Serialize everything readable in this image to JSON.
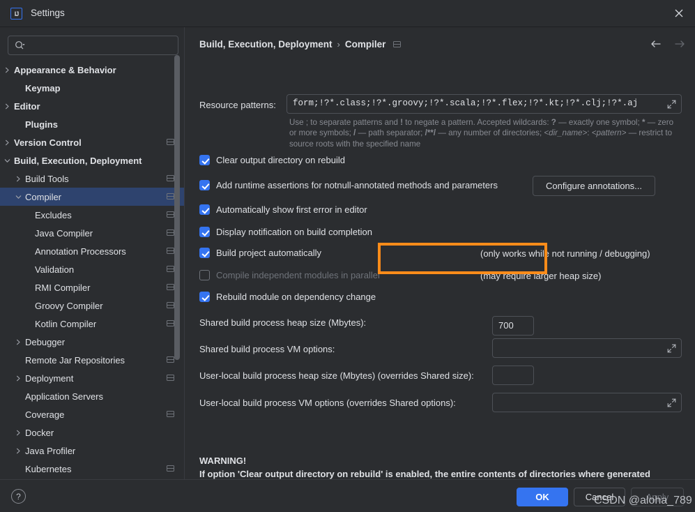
{
  "window": {
    "title": "Settings",
    "logo_text": "IJ",
    "close_icon": "close-icon"
  },
  "sidebar": {
    "search": {
      "placeholder": "",
      "value": "",
      "icon": "search-icon"
    },
    "items": [
      {
        "label": "Appearance & Behavior",
        "indent": 20,
        "arrow": "right",
        "bold": true,
        "badge": false,
        "selected": false
      },
      {
        "label": "Keymap",
        "indent": 36,
        "arrow": "none",
        "bold": true,
        "badge": false,
        "selected": false
      },
      {
        "label": "Editor",
        "indent": 20,
        "arrow": "right",
        "bold": true,
        "badge": false,
        "selected": false
      },
      {
        "label": "Plugins",
        "indent": 36,
        "arrow": "none",
        "bold": true,
        "badge": false,
        "selected": false
      },
      {
        "label": "Version Control",
        "indent": 20,
        "arrow": "right",
        "bold": true,
        "badge": true,
        "selected": false
      },
      {
        "label": "Build, Execution, Deployment",
        "indent": 20,
        "arrow": "down",
        "bold": true,
        "badge": false,
        "selected": false
      },
      {
        "label": "Build Tools",
        "indent": 36,
        "arrow": "right",
        "bold": false,
        "badge": true,
        "selected": false
      },
      {
        "label": "Compiler",
        "indent": 36,
        "arrow": "down",
        "bold": false,
        "badge": true,
        "selected": true
      },
      {
        "label": "Excludes",
        "indent": 50,
        "arrow": "none",
        "bold": false,
        "badge": true,
        "selected": false
      },
      {
        "label": "Java Compiler",
        "indent": 50,
        "arrow": "none",
        "bold": false,
        "badge": true,
        "selected": false
      },
      {
        "label": "Annotation Processors",
        "indent": 50,
        "arrow": "none",
        "bold": false,
        "badge": true,
        "selected": false
      },
      {
        "label": "Validation",
        "indent": 50,
        "arrow": "none",
        "bold": false,
        "badge": true,
        "selected": false
      },
      {
        "label": "RMI Compiler",
        "indent": 50,
        "arrow": "none",
        "bold": false,
        "badge": true,
        "selected": false
      },
      {
        "label": "Groovy Compiler",
        "indent": 50,
        "arrow": "none",
        "bold": false,
        "badge": true,
        "selected": false
      },
      {
        "label": "Kotlin Compiler",
        "indent": 50,
        "arrow": "none",
        "bold": false,
        "badge": true,
        "selected": false
      },
      {
        "label": "Debugger",
        "indent": 36,
        "arrow": "right",
        "bold": false,
        "badge": false,
        "selected": false
      },
      {
        "label": "Remote Jar Repositories",
        "indent": 36,
        "arrow": "none",
        "bold": false,
        "badge": true,
        "selected": false
      },
      {
        "label": "Deployment",
        "indent": 36,
        "arrow": "right",
        "bold": false,
        "badge": true,
        "selected": false
      },
      {
        "label": "Application Servers",
        "indent": 36,
        "arrow": "none",
        "bold": false,
        "badge": false,
        "selected": false
      },
      {
        "label": "Coverage",
        "indent": 36,
        "arrow": "none",
        "bold": false,
        "badge": true,
        "selected": false
      },
      {
        "label": "Docker",
        "indent": 36,
        "arrow": "right",
        "bold": false,
        "badge": false,
        "selected": false
      },
      {
        "label": "Java Profiler",
        "indent": 36,
        "arrow": "right",
        "bold": false,
        "badge": false,
        "selected": false
      },
      {
        "label": "Kubernetes",
        "indent": 36,
        "arrow": "none",
        "bold": false,
        "badge": true,
        "selected": false
      }
    ]
  },
  "main": {
    "breadcrumb": {
      "root": "Build, Execution, Deployment",
      "separator": "›",
      "leaf": "Compiler"
    },
    "nav": {
      "back_icon": "arrow-left-icon",
      "forward_icon": "arrow-right-icon"
    },
    "resource_patterns": {
      "label": "Resource patterns:",
      "value": "form;!?*.class;!?*.groovy;!?*.scala;!?*.flex;!?*.kt;!?*.clj;!?*.aj",
      "expand_icon": "expand-icon",
      "hint_line1_a": "Use ; to separate patterns and ",
      "hint_bang": "!",
      "hint_line1_b": " to negate a pattern. Accepted wildcards: ",
      "hint_q": "?",
      "hint_line1_c": " — exactly one symbol; ",
      "hint_star": "*",
      "hint_line1_d": " — zero or more symbols; ",
      "hint_slash": "/",
      "hint_line2_a": " — path separator; ",
      "hint_dstar": "/**/",
      "hint_line2_b": " — any number of directories; ",
      "hint_dir": "<dir_name>",
      "hint_colon": ": ",
      "hint_pattern": "<pattern>",
      "hint_line2_c": " — restrict to source roots with the specified name"
    },
    "checkboxes": [
      {
        "label": "Clear output directory on rebuild",
        "checked": true,
        "disabled": false,
        "note": ""
      },
      {
        "label": "Add runtime assertions for notnull-annotated methods and parameters",
        "checked": true,
        "disabled": false,
        "note": ""
      },
      {
        "label": "Automatically show first error in editor",
        "checked": true,
        "disabled": false,
        "note": ""
      },
      {
        "label": "Display notification on build completion",
        "checked": true,
        "disabled": false,
        "note": ""
      },
      {
        "label": "Build project automatically",
        "checked": true,
        "disabled": false,
        "note": "(only works while not running / debugging)"
      },
      {
        "label": "Compile independent modules in parallel",
        "checked": false,
        "disabled": true,
        "note": "(may require larger heap size)"
      },
      {
        "label": "Rebuild module on dependency change",
        "checked": true,
        "disabled": false,
        "note": ""
      }
    ],
    "configure_annotations_button": "Configure annotations...",
    "fields": [
      {
        "label": "Shared build process heap size (Mbytes):",
        "value": "700",
        "expandable": false
      },
      {
        "label": "Shared build process VM options:",
        "value": "",
        "expandable": true
      },
      {
        "label": "User-local build process heap size (Mbytes) (overrides Shared size):",
        "value": "",
        "expandable": false
      },
      {
        "label": "User-local build process VM options (overrides Shared options):",
        "value": "",
        "expandable": true
      }
    ],
    "warning": {
      "title": "WARNING!",
      "body": "If option 'Clear output directory on rebuild' is enabled, the entire contents of directories where generated sources are stored WILL BE CLEARED on rebuild."
    }
  },
  "footer": {
    "help_label": "?",
    "ok_label": "OK",
    "cancel_label": "Cancel",
    "apply_label": "Apply"
  },
  "watermark": "CSDN @aloha_789",
  "colors": {
    "accent": "#3574f0",
    "selection": "#2e436e",
    "highlight_annotation": "#ff8c1a",
    "background": "#2b2d30",
    "border": "#4e5157",
    "text": "#dfe1e5",
    "muted_text": "#878a91"
  }
}
